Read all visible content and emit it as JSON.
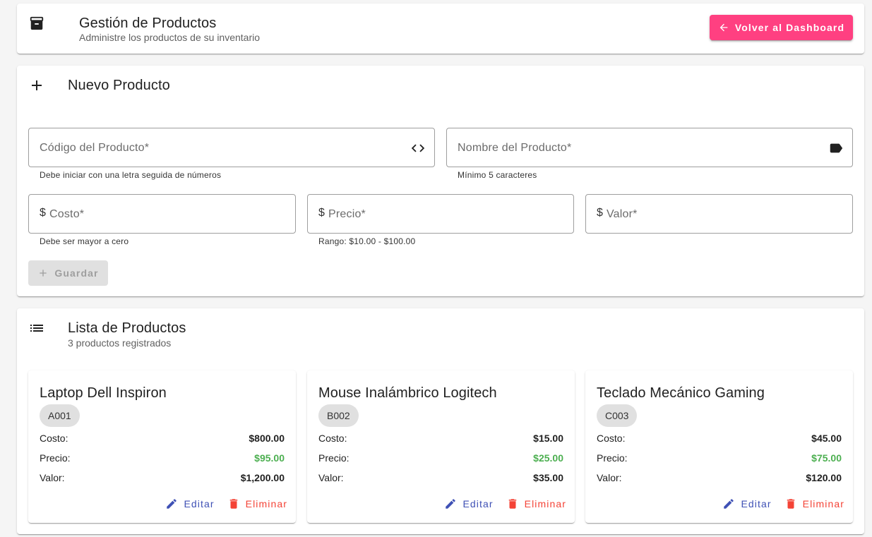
{
  "header": {
    "title": "Gestión de Productos",
    "subtitle": "Administre los productos de su inventario",
    "back_button": "Volver al Dashboard",
    "accent": "#ff4081"
  },
  "new_product": {
    "title": "Nuevo Producto",
    "fields": {
      "code": {
        "placeholder": "Código del Producto*",
        "hint": "Debe iniciar con una letra seguida de números",
        "icon": "code-icon"
      },
      "name": {
        "placeholder": "Nombre del Producto*",
        "hint": "Mínimo 5 caracteres",
        "icon": "label-icon"
      },
      "cost": {
        "prefix": "$",
        "placeholder": "Costo*",
        "hint": "Debe ser mayor a cero"
      },
      "price": {
        "prefix": "$",
        "placeholder": "Precio*",
        "hint": "Rango: $10.00 - $100.00"
      },
      "value": {
        "prefix": "$",
        "placeholder": "Valor*"
      }
    },
    "save_button": "Guardar"
  },
  "product_list": {
    "title": "Lista de Productos",
    "subtitle": "3 productos registrados",
    "labels": {
      "cost": "Costo:",
      "price": "Precio:",
      "value": "Valor:"
    },
    "edit_label": "Editar",
    "delete_label": "Eliminar",
    "items": [
      {
        "name": "Laptop Dell Inspiron",
        "code": "A001",
        "cost": "$800.00",
        "price": "$95.00",
        "value": "$1,200.00"
      },
      {
        "name": "Mouse Inalámbrico Logitech",
        "code": "B002",
        "cost": "$15.00",
        "price": "$25.00",
        "value": "$35.00"
      },
      {
        "name": "Teclado Mecánico Gaming",
        "code": "C003",
        "cost": "$45.00",
        "price": "$75.00",
        "value": "$120.00"
      }
    ]
  },
  "colors": {
    "edit": "#3f51b5",
    "delete": "#f44336",
    "price": "#4caf50"
  }
}
